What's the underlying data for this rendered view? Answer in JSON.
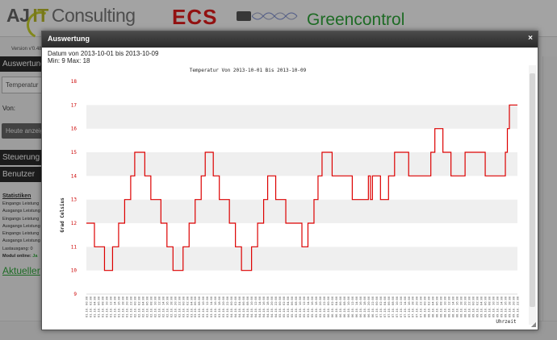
{
  "header": {
    "logo_aj": "AJ",
    "logo_it": "IT",
    "logo_consulting": "Consulting",
    "version": "Version v'0.48",
    "ecs": "ECS",
    "greencontrol": "Greencontrol"
  },
  "sidebar": {
    "auswertung": "Auswertung",
    "select_value": "Temperatur",
    "von_label": "Von:",
    "heute_button": "Heute anzeigen",
    "menu": [
      "Steuerung",
      "Benutzer"
    ],
    "stat_title": "Statistiken",
    "stat_lines": [
      "Eingangs Leistung",
      "Ausgangs Leistung",
      "Eingangs Leistung",
      "Ausgangs Leistung",
      "Eingangs Leistung",
      "Ausgangs Leistung",
      "Lastausgang: 0"
    ],
    "modul_label": "Modul online:",
    "modul_value": "Ja",
    "aktuell_link": "Aktueller"
  },
  "dialog": {
    "title": "Auswertung",
    "close": "×",
    "range_text": "Datum von 2013-10-01 bis 2013-10-09",
    "minmax_text": "Min: 9 Max: 18",
    "resize_glyph": "◢"
  },
  "colors": {
    "line": "#dd0000",
    "band": "#efefef",
    "tick_label": "#cc0000",
    "titlebar": "#333333",
    "brand_green": "#2ea53a",
    "brand_red": "#e01b1b"
  },
  "chart_data": {
    "type": "line",
    "title": "Temperatur Von 2013-10-01 Bis 2013-10-09",
    "ylabel": "Grad Celsius",
    "xlabel": "Uhrzeit",
    "ylim": [
      9,
      18
    ],
    "yticks": [
      9,
      10,
      11,
      12,
      13,
      14,
      15,
      16,
      17,
      18
    ],
    "xlim": [
      "2013-10-01 00:00",
      "2013-10-09 22:00"
    ],
    "x_tick_step_hours": 2,
    "grid": "alternating horizontal bands",
    "series": [
      {
        "color": "#dd0000",
        "points": [
          [
            "2013-10-01 00:00",
            12
          ],
          [
            "2013-10-01 04:00",
            11
          ],
          [
            "2013-10-01 09:00",
            10
          ],
          [
            "2013-10-01 13:00",
            11
          ],
          [
            "2013-10-01 16:00",
            12
          ],
          [
            "2013-10-01 19:00",
            13
          ],
          [
            "2013-10-01 22:00",
            14
          ],
          [
            "2013-10-02 00:00",
            15
          ],
          [
            "2013-10-02 05:00",
            14
          ],
          [
            "2013-10-02 08:00",
            13
          ],
          [
            "2013-10-02 13:00",
            12
          ],
          [
            "2013-10-02 16:00",
            11
          ],
          [
            "2013-10-02 19:00",
            10
          ],
          [
            "2013-10-03 00:00",
            11
          ],
          [
            "2013-10-03 03:00",
            12
          ],
          [
            "2013-10-03 06:00",
            13
          ],
          [
            "2013-10-03 09:00",
            14
          ],
          [
            "2013-10-03 11:00",
            15
          ],
          [
            "2013-10-03 15:00",
            14
          ],
          [
            "2013-10-03 18:00",
            13
          ],
          [
            "2013-10-03 23:00",
            12
          ],
          [
            "2013-10-04 02:00",
            11
          ],
          [
            "2013-10-04 05:00",
            10
          ],
          [
            "2013-10-04 10:00",
            11
          ],
          [
            "2013-10-04 13:00",
            12
          ],
          [
            "2013-10-04 16:00",
            13
          ],
          [
            "2013-10-04 18:00",
            14
          ],
          [
            "2013-10-04 22:00",
            13
          ],
          [
            "2013-10-05 03:00",
            12
          ],
          [
            "2013-10-05 11:00",
            11
          ],
          [
            "2013-10-05 14:00",
            12
          ],
          [
            "2013-10-05 17:00",
            13
          ],
          [
            "2013-10-05 19:00",
            14
          ],
          [
            "2013-10-05 21:00",
            15
          ],
          [
            "2013-10-06 02:00",
            14
          ],
          [
            "2013-10-06 12:00",
            13
          ],
          [
            "2013-10-06 20:00",
            14
          ],
          [
            "2013-10-06 21:00",
            13
          ],
          [
            "2013-10-06 22:00",
            14
          ],
          [
            "2013-10-07 02:00",
            13
          ],
          [
            "2013-10-07 06:00",
            14
          ],
          [
            "2013-10-07 09:00",
            15
          ],
          [
            "2013-10-07 16:00",
            14
          ],
          [
            "2013-10-08 03:00",
            15
          ],
          [
            "2013-10-08 05:00",
            16
          ],
          [
            "2013-10-08 09:00",
            15
          ],
          [
            "2013-10-08 13:00",
            14
          ],
          [
            "2013-10-08 20:00",
            15
          ],
          [
            "2013-10-09 06:00",
            14
          ],
          [
            "2013-10-09 16:00",
            15
          ],
          [
            "2013-10-09 17:00",
            16
          ],
          [
            "2013-10-09 18:00",
            17
          ],
          [
            "2013-10-09 22:00",
            17
          ]
        ]
      }
    ]
  }
}
